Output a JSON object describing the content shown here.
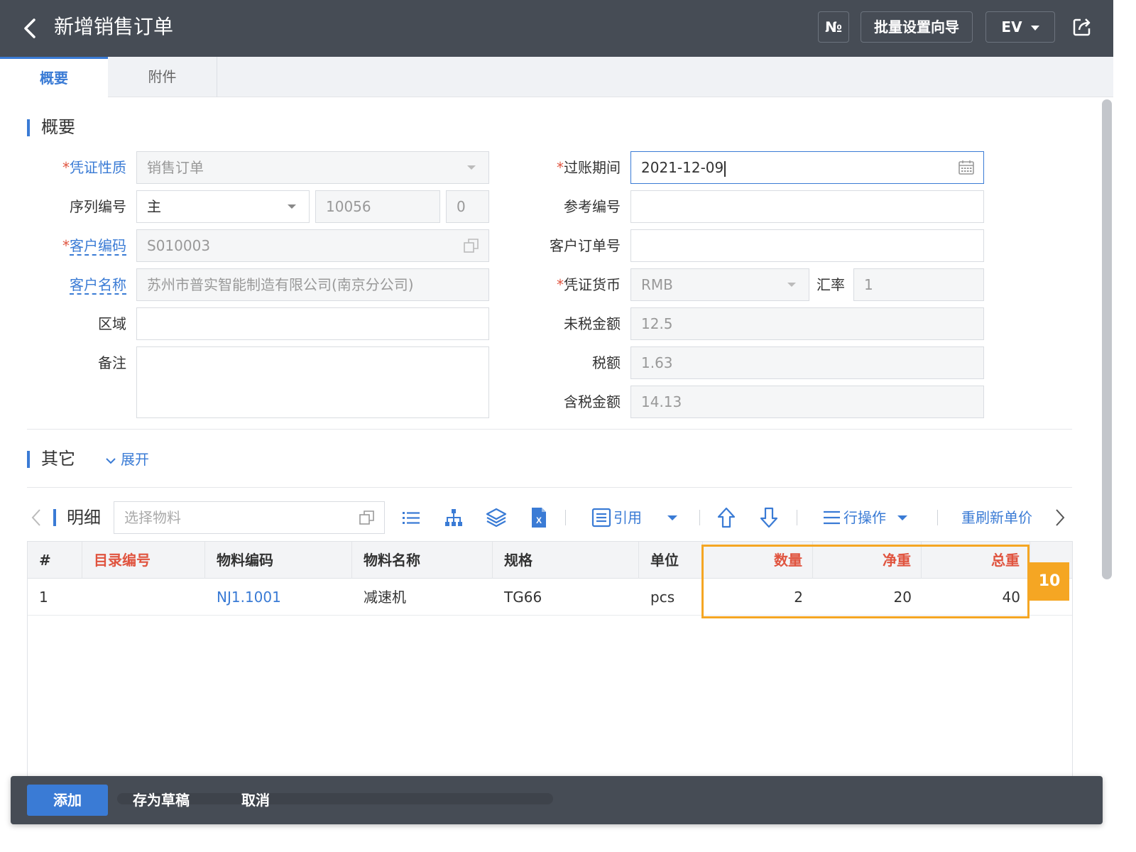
{
  "header": {
    "title": "新增销售订单",
    "no_label": "№",
    "batch_label": "批量设置向导",
    "ev_label": "EV"
  },
  "tabs": [
    {
      "label": "概要",
      "active": true
    },
    {
      "label": "附件",
      "active": false
    }
  ],
  "overview": {
    "section_title": "概要",
    "left_fields": {
      "voucher_type": {
        "label": "凭证性质",
        "value": "销售订单"
      },
      "serial": {
        "label": "序列编号",
        "value": "主",
        "number": "10056",
        "suffix": "0"
      },
      "customer_code": {
        "label": "客户编码",
        "value": "S010003"
      },
      "customer_name": {
        "label": "客户名称",
        "value": "苏州市普实智能制造有限公司(南京分公司)"
      },
      "region": {
        "label": "区域",
        "value": ""
      },
      "remark": {
        "label": "备注",
        "value": ""
      }
    },
    "right_fields": {
      "posting_period": {
        "label": "过账期间",
        "value": "2021-12-09"
      },
      "reference_no": {
        "label": "参考编号",
        "value": ""
      },
      "customer_order_no": {
        "label": "客户订单号",
        "value": ""
      },
      "currency": {
        "label": "凭证货币",
        "value": "RMB"
      },
      "exchange_rate": {
        "label": "汇率",
        "value": "1"
      },
      "amount_before_tax": {
        "label": "未税金额",
        "value": "12.5"
      },
      "tax": {
        "label": "税额",
        "value": "1.63"
      },
      "amount_with_tax": {
        "label": "含税金额",
        "value": "14.13"
      }
    },
    "required_mark": "*"
  },
  "other": {
    "section_title": "其它",
    "expand_label": "展开"
  },
  "detail": {
    "title": "明细",
    "material_placeholder": "选择物料",
    "toolbar": {
      "reference_label": "引用",
      "row_ops_label": "行操作",
      "refresh_price_label": "重刷新单价"
    },
    "columns": [
      "#",
      "目录编号",
      "物料编码",
      "物料名称",
      "规格",
      "单位",
      "数量",
      "净重",
      "总重"
    ],
    "rows": [
      {
        "index": "1",
        "catalog_no": "",
        "material_code": "NJ1.1001",
        "material_name": "减速机",
        "spec": "TG66",
        "unit": "pcs",
        "qty": "2",
        "net_weight": "20",
        "total_weight": "40"
      }
    ]
  },
  "annotation": {
    "callout": "10",
    "color": "#f5a623"
  },
  "footer": {
    "add_label": "添加",
    "draft_label": "存为草稿",
    "cancel_label": "取消"
  },
  "colors": {
    "accent": "#3a7bd5",
    "header_bg": "#464c55",
    "required": "#e0543f"
  }
}
